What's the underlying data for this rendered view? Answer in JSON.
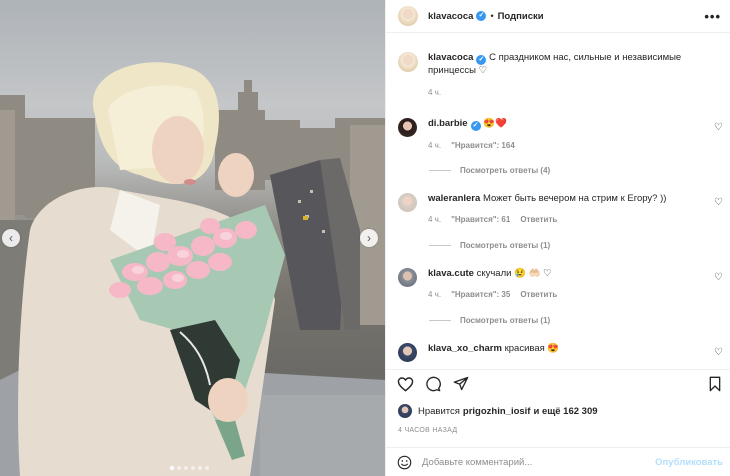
{
  "post": {
    "carousel": {
      "slide_count": 6,
      "active_index": 0
    }
  },
  "header": {
    "username": "klavacoca",
    "separator": "•",
    "follow_label": "Подписки",
    "more_label": "•••"
  },
  "caption": {
    "username": "klavacoca",
    "text": "С праздником нас, сильные и независимые принцессы ♡",
    "time": "4 ч."
  },
  "comments": [
    {
      "username": "di.barbie",
      "verified": true,
      "text": "😍❤️",
      "time": "4 ч.",
      "likes": "\"Нравится\": 164",
      "reply": "",
      "view_replies": "Посмотреть ответы (4)"
    },
    {
      "username": "waleranlera",
      "verified": false,
      "text": "Может быть вечером на стрим к Егору? ))",
      "time": "4 ч.",
      "likes": "\"Нравится\": 61",
      "reply": "Ответить",
      "view_replies": "Посмотреть ответы (1)"
    },
    {
      "username": "klava.cute",
      "verified": false,
      "text": "скучали 😢 🤲🏻 ♡",
      "time": "4 ч.",
      "likes": "\"Нравится\": 35",
      "reply": "Ответить",
      "view_replies": "Посмотреть ответы (1)"
    },
    {
      "username": "klava_xo_charm",
      "verified": false,
      "text": "красивая 😍",
      "time": "",
      "likes": "",
      "reply": "",
      "view_replies": ""
    }
  ],
  "likes": {
    "prefix": "Нравится",
    "username": "prigozhin_iosif",
    "suffix": "и ещё 162 309"
  },
  "posted_time": "4 ЧАСОВ НАЗАД",
  "add_comment": {
    "placeholder": "Добавьте комментарий...",
    "publish_label": "Опубликовать"
  },
  "colors": {
    "verified": "#3897f0",
    "publish_disabled": "#b2dffc",
    "muted_text": "#8e8e8e"
  },
  "icons": [
    "heart-icon",
    "comment-icon",
    "share-icon",
    "bookmark-icon",
    "emoji-icon",
    "more-icon",
    "verified-icon",
    "chevron-left-icon",
    "chevron-right-icon"
  ]
}
